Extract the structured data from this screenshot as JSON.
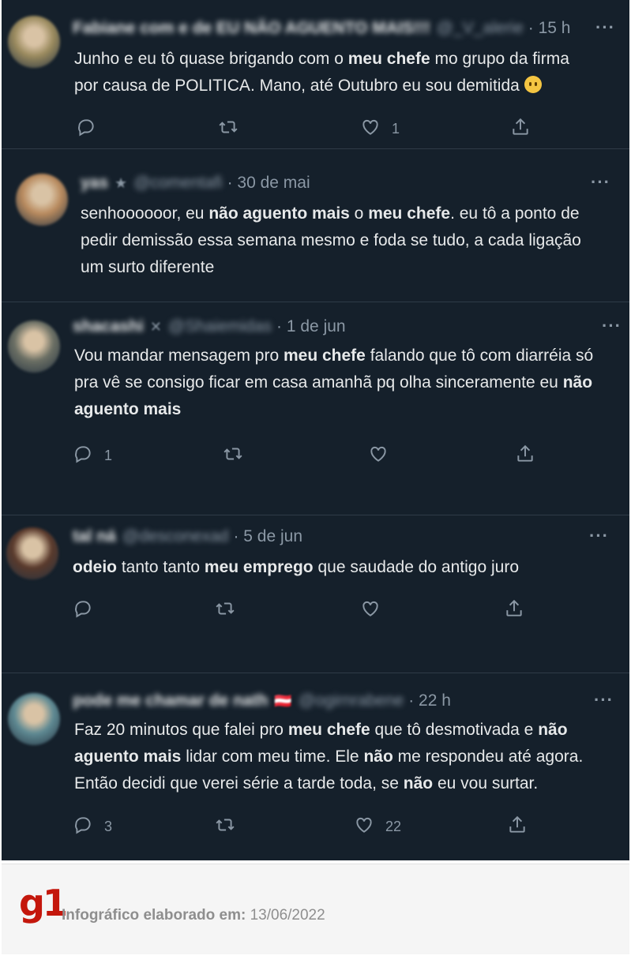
{
  "tweets": [
    {
      "name": "Fabiane com e de EU NÃO AGUENTO MAIS!!!",
      "handle": "@_V_alerie",
      "badge": "",
      "time": "· 15 h",
      "segments": [
        {
          "t": "Junho e eu tô quase brigando com o ",
          "b": false
        },
        {
          "t": "meu chefe",
          "b": true
        },
        {
          "t": " mo grupo da firma por causa de POLITICA. Mano, até Outubro eu sou demitida ",
          "b": false
        }
      ],
      "emoji": "neutral-face-emoji",
      "reply_count": "",
      "retweet_count": "",
      "like_count": "1",
      "avatar_color": "#9a8a5e"
    },
    {
      "name": "yas",
      "handle": "@comentafi",
      "badge": "★",
      "time": "· 30 de mai",
      "segments": [
        {
          "t": "senhoooooor, eu ",
          "b": false
        },
        {
          "t": "não aguento mais",
          "b": true
        },
        {
          "t": " o ",
          "b": false
        },
        {
          "t": "meu chefe",
          "b": true
        },
        {
          "t": ". eu tô a ponto de pedir demissão essa semana mesmo e foda se tudo, a cada ligação um surto diferente",
          "b": false
        }
      ],
      "emoji": "",
      "reply_count": "",
      "retweet_count": "",
      "like_count": "",
      "avatar_color": "#b88a5e"
    },
    {
      "name": "shacashi",
      "handle": "@Shaiemidas",
      "badge": "✕",
      "time": "· 1 de jun",
      "segments": [
        {
          "t": "Vou mandar mensagem pro ",
          "b": false
        },
        {
          "t": "meu chefe",
          "b": true
        },
        {
          "t": " falando que tô com diarréia só pra vê se consigo ficar em casa amanhã pq olha sinceramente eu ",
          "b": false
        },
        {
          "t": "não aguento mais",
          "b": true
        }
      ],
      "emoji": "",
      "reply_count": "1",
      "retweet_count": "",
      "like_count": "",
      "avatar_color": "#6b6f64"
    },
    {
      "name": "tal ná",
      "handle": "@desconexad",
      "badge": "",
      "time": "· 5 de jun",
      "segments": [
        {
          "t": "odeio",
          "b": true
        },
        {
          "t": " tanto tanto ",
          "b": false
        },
        {
          "t": "meu emprego",
          "b": true
        },
        {
          "t": " que saudade do antigo juro",
          "b": false
        }
      ],
      "emoji": "",
      "reply_count": "",
      "retweet_count": "",
      "like_count": "",
      "avatar_color": "#5a3a2c"
    },
    {
      "name": "pode me chamar de nath",
      "handle": "@ogirnrabene",
      "badge": "🇦🇹",
      "time": "· 22 h",
      "segments": [
        {
          "t": "Faz 20 minutos que falei pro ",
          "b": false
        },
        {
          "t": "meu chefe",
          "b": true
        },
        {
          "t": " que tô desmotivada e ",
          "b": false
        },
        {
          "t": "não aguento mais",
          "b": true
        },
        {
          "t": " lidar com meu time. Ele ",
          "b": false
        },
        {
          "t": "não",
          "b": true
        },
        {
          "t": " me respondeu até agora. Então decidi que verei série a tarde toda, se ",
          "b": false
        },
        {
          "t": "não",
          "b": true
        },
        {
          "t": " eu vou surtar.",
          "b": false
        }
      ],
      "emoji": "",
      "reply_count": "3",
      "retweet_count": "",
      "like_count": "22",
      "avatar_color": "#5f8a93"
    }
  ],
  "footer": {
    "logo": "g1",
    "credit_label": "Infográfico elaborado em:",
    "credit_date": " 13/06/2022",
    "brand_color": "#c4170c"
  },
  "more_glyph": "···",
  "icons": [
    "reply-icon",
    "retweet-icon",
    "like-icon",
    "share-icon"
  ]
}
